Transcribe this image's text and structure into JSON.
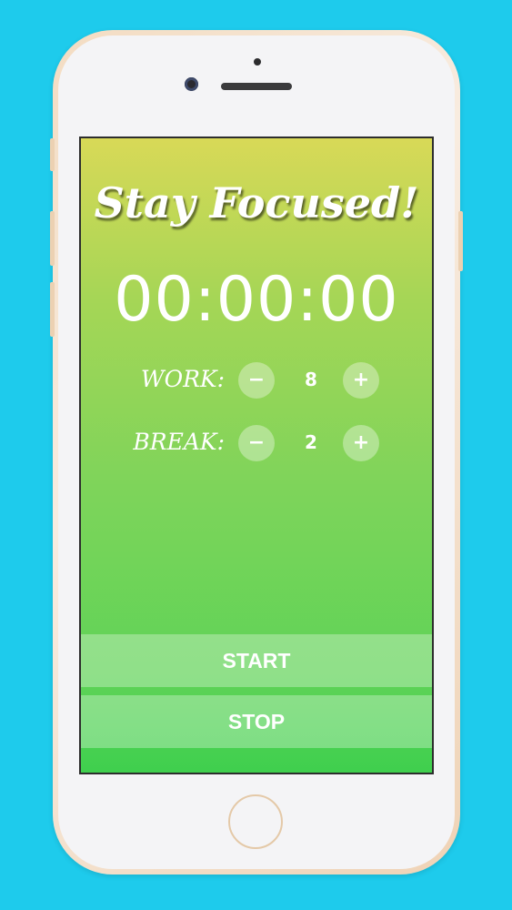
{
  "app": {
    "title": "Stay Focused!",
    "timer": "00:00:00"
  },
  "work": {
    "label": "WORK:",
    "minus": "−",
    "value": "8",
    "plus": "+"
  },
  "break": {
    "label": "BREAK:",
    "minus": "−",
    "value": "2",
    "plus": "+"
  },
  "controls": {
    "start_label": "START",
    "stop_label": "STOP"
  },
  "colors": {
    "background": "#1ecbec",
    "screen_top": "#d8d957",
    "screen_bottom": "#3fcf4e"
  }
}
